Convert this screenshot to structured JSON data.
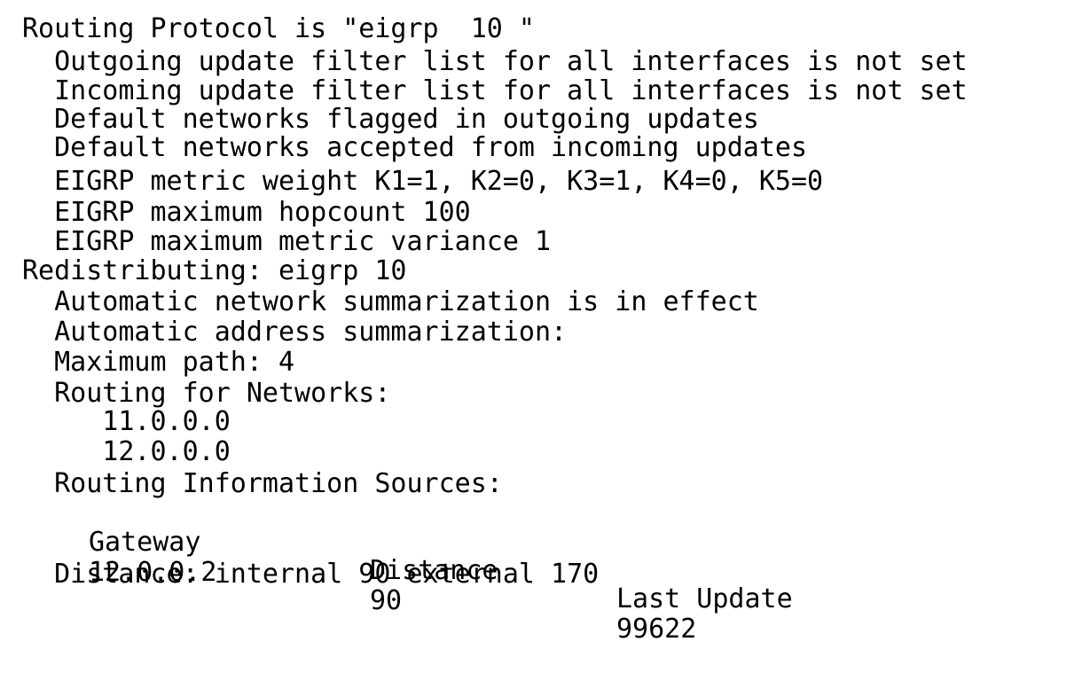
{
  "terminal": {
    "lines": [
      "Routing Protocol is \"eigrp  10 \"",
      "  Outgoing update filter list for all interfaces is not set",
      "  Incoming update filter list for all interfaces is not set",
      "  Default networks flagged in outgoing updates",
      "  Default networks accepted from incoming updates",
      "  EIGRP metric weight K1=1, K2=0, K3=1, K4=0, K5=0",
      "  EIGRP maximum hopcount 100",
      "  EIGRP maximum metric variance 1",
      "Redistributing: eigrp 10",
      "  Automatic network summarization is in effect",
      "  Automatic address summarization:",
      "  Maximum path: 4",
      "  Routing for Networks:",
      "     11.0.0.0",
      "     12.0.0.0",
      "  Routing Information Sources:"
    ],
    "sources_header": {
      "gateway": "Gateway",
      "distance": "Distance",
      "last_update": "Last Update"
    },
    "sources_row": {
      "gateway": "12.0.0.2",
      "distance": "90",
      "last_update": "99622"
    },
    "distance_line": "  Distance: internal 90 external 170"
  },
  "colors": {
    "background": "#ffffff",
    "text": "#000000"
  }
}
